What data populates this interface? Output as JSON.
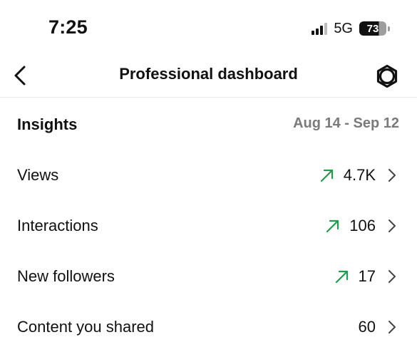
{
  "status_bar": {
    "time": "7:25",
    "network": "5G",
    "battery": "73"
  },
  "nav": {
    "title": "Professional dashboard",
    "back_icon": "chevron-left-icon",
    "settings_icon": "gear-icon"
  },
  "insights": {
    "title": "Insights",
    "date_range": "Aug 14 - Sep 12",
    "rows": [
      {
        "label": "Views",
        "value": "4.7K",
        "trend": "up"
      },
      {
        "label": "Interactions",
        "value": "106",
        "trend": "up"
      },
      {
        "label": "New followers",
        "value": "17",
        "trend": "up"
      },
      {
        "label": "Content you shared",
        "value": "60",
        "trend": "none"
      }
    ]
  },
  "colors": {
    "trend_up": "#1f9d4a",
    "muted_text": "#7a7a7a",
    "text": "#111111"
  }
}
